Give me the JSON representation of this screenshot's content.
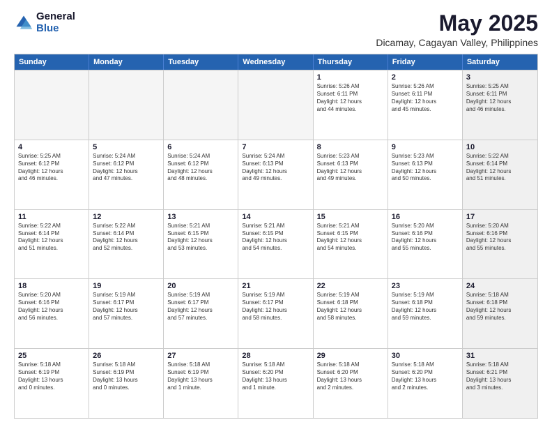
{
  "logo": {
    "general": "General",
    "blue": "Blue"
  },
  "title": "May 2025",
  "subtitle": "Dicamay, Cagayan Valley, Philippines",
  "headers": [
    "Sunday",
    "Monday",
    "Tuesday",
    "Wednesday",
    "Thursday",
    "Friday",
    "Saturday"
  ],
  "weeks": [
    [
      {
        "day": "",
        "info": "",
        "shaded": true
      },
      {
        "day": "",
        "info": "",
        "shaded": true
      },
      {
        "day": "",
        "info": "",
        "shaded": true
      },
      {
        "day": "",
        "info": "",
        "shaded": true
      },
      {
        "day": "1",
        "info": "Sunrise: 5:26 AM\nSunset: 6:11 PM\nDaylight: 12 hours\nand 44 minutes.",
        "shaded": false
      },
      {
        "day": "2",
        "info": "Sunrise: 5:26 AM\nSunset: 6:11 PM\nDaylight: 12 hours\nand 45 minutes.",
        "shaded": false
      },
      {
        "day": "3",
        "info": "Sunrise: 5:25 AM\nSunset: 6:11 PM\nDaylight: 12 hours\nand 46 minutes.",
        "shaded": true
      }
    ],
    [
      {
        "day": "4",
        "info": "Sunrise: 5:25 AM\nSunset: 6:12 PM\nDaylight: 12 hours\nand 46 minutes.",
        "shaded": false
      },
      {
        "day": "5",
        "info": "Sunrise: 5:24 AM\nSunset: 6:12 PM\nDaylight: 12 hours\nand 47 minutes.",
        "shaded": false
      },
      {
        "day": "6",
        "info": "Sunrise: 5:24 AM\nSunset: 6:12 PM\nDaylight: 12 hours\nand 48 minutes.",
        "shaded": false
      },
      {
        "day": "7",
        "info": "Sunrise: 5:24 AM\nSunset: 6:13 PM\nDaylight: 12 hours\nand 49 minutes.",
        "shaded": false
      },
      {
        "day": "8",
        "info": "Sunrise: 5:23 AM\nSunset: 6:13 PM\nDaylight: 12 hours\nand 49 minutes.",
        "shaded": false
      },
      {
        "day": "9",
        "info": "Sunrise: 5:23 AM\nSunset: 6:13 PM\nDaylight: 12 hours\nand 50 minutes.",
        "shaded": false
      },
      {
        "day": "10",
        "info": "Sunrise: 5:22 AM\nSunset: 6:14 PM\nDaylight: 12 hours\nand 51 minutes.",
        "shaded": true
      }
    ],
    [
      {
        "day": "11",
        "info": "Sunrise: 5:22 AM\nSunset: 6:14 PM\nDaylight: 12 hours\nand 51 minutes.",
        "shaded": false
      },
      {
        "day": "12",
        "info": "Sunrise: 5:22 AM\nSunset: 6:14 PM\nDaylight: 12 hours\nand 52 minutes.",
        "shaded": false
      },
      {
        "day": "13",
        "info": "Sunrise: 5:21 AM\nSunset: 6:15 PM\nDaylight: 12 hours\nand 53 minutes.",
        "shaded": false
      },
      {
        "day": "14",
        "info": "Sunrise: 5:21 AM\nSunset: 6:15 PM\nDaylight: 12 hours\nand 54 minutes.",
        "shaded": false
      },
      {
        "day": "15",
        "info": "Sunrise: 5:21 AM\nSunset: 6:15 PM\nDaylight: 12 hours\nand 54 minutes.",
        "shaded": false
      },
      {
        "day": "16",
        "info": "Sunrise: 5:20 AM\nSunset: 6:16 PM\nDaylight: 12 hours\nand 55 minutes.",
        "shaded": false
      },
      {
        "day": "17",
        "info": "Sunrise: 5:20 AM\nSunset: 6:16 PM\nDaylight: 12 hours\nand 55 minutes.",
        "shaded": true
      }
    ],
    [
      {
        "day": "18",
        "info": "Sunrise: 5:20 AM\nSunset: 6:16 PM\nDaylight: 12 hours\nand 56 minutes.",
        "shaded": false
      },
      {
        "day": "19",
        "info": "Sunrise: 5:19 AM\nSunset: 6:17 PM\nDaylight: 12 hours\nand 57 minutes.",
        "shaded": false
      },
      {
        "day": "20",
        "info": "Sunrise: 5:19 AM\nSunset: 6:17 PM\nDaylight: 12 hours\nand 57 minutes.",
        "shaded": false
      },
      {
        "day": "21",
        "info": "Sunrise: 5:19 AM\nSunset: 6:17 PM\nDaylight: 12 hours\nand 58 minutes.",
        "shaded": false
      },
      {
        "day": "22",
        "info": "Sunrise: 5:19 AM\nSunset: 6:18 PM\nDaylight: 12 hours\nand 58 minutes.",
        "shaded": false
      },
      {
        "day": "23",
        "info": "Sunrise: 5:19 AM\nSunset: 6:18 PM\nDaylight: 12 hours\nand 59 minutes.",
        "shaded": false
      },
      {
        "day": "24",
        "info": "Sunrise: 5:18 AM\nSunset: 6:18 PM\nDaylight: 12 hours\nand 59 minutes.",
        "shaded": true
      }
    ],
    [
      {
        "day": "25",
        "info": "Sunrise: 5:18 AM\nSunset: 6:19 PM\nDaylight: 13 hours\nand 0 minutes.",
        "shaded": false
      },
      {
        "day": "26",
        "info": "Sunrise: 5:18 AM\nSunset: 6:19 PM\nDaylight: 13 hours\nand 0 minutes.",
        "shaded": false
      },
      {
        "day": "27",
        "info": "Sunrise: 5:18 AM\nSunset: 6:19 PM\nDaylight: 13 hours\nand 1 minute.",
        "shaded": false
      },
      {
        "day": "28",
        "info": "Sunrise: 5:18 AM\nSunset: 6:20 PM\nDaylight: 13 hours\nand 1 minute.",
        "shaded": false
      },
      {
        "day": "29",
        "info": "Sunrise: 5:18 AM\nSunset: 6:20 PM\nDaylight: 13 hours\nand 2 minutes.",
        "shaded": false
      },
      {
        "day": "30",
        "info": "Sunrise: 5:18 AM\nSunset: 6:20 PM\nDaylight: 13 hours\nand 2 minutes.",
        "shaded": false
      },
      {
        "day": "31",
        "info": "Sunrise: 5:18 AM\nSunset: 6:21 PM\nDaylight: 13 hours\nand 3 minutes.",
        "shaded": true
      }
    ]
  ]
}
